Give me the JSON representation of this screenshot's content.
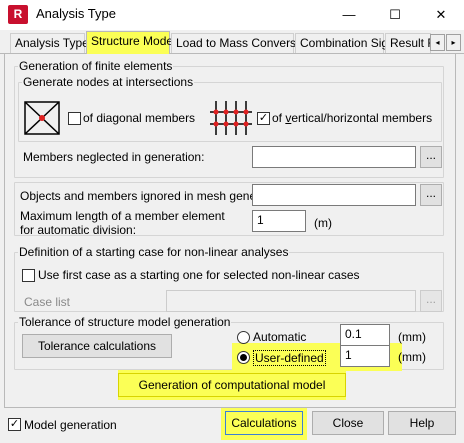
{
  "window": {
    "app_icon_text": "R",
    "title": "Analysis Type",
    "minimize_glyph": "—",
    "maximize_glyph": "☐",
    "close_glyph": "✕"
  },
  "tabs": [
    {
      "label": "Analysis Types"
    },
    {
      "label": "Structure Model"
    },
    {
      "label": "Load to Mass Conversion"
    },
    {
      "label": "Combination Sign"
    },
    {
      "label": "Result Fi"
    }
  ],
  "tab_scroll": {
    "left": "◂",
    "right": "▸"
  },
  "generation": {
    "group_label": "Generation of finite elements",
    "nodes": {
      "group_label": "Generate nodes at intersections",
      "diagonal_label": "of diagonal members",
      "diagonal_checked": false,
      "vertical_prefix": "of ",
      "vertical_underlined": "v",
      "vertical_rest": "ertical/horizontal members",
      "vertical_checked": true
    },
    "neglected_label": "Members neglected in generation:",
    "neglected_value": "",
    "ellipsis": "..."
  },
  "mesh": {
    "ignored_label": "Objects and members ignored in mesh generatic",
    "ignored_value": "",
    "max_length_label_line1": "Maximum length of a member element",
    "max_length_label_line2": "for automatic division:",
    "max_length_value": "1",
    "unit": "(m)",
    "ellipsis": "..."
  },
  "nonlinear": {
    "group_label": "Definition of a starting case for non-linear analyses",
    "use_first_label": "Use first case as a starting one for selected non-linear cases",
    "use_first_checked": false,
    "case_list_label": "Case list",
    "case_list_value": "",
    "ellipsis": "..."
  },
  "tolerance": {
    "group_label": "Tolerance of structure model generation",
    "calc_button": "Tolerance calculations",
    "automatic_label": "Automatic",
    "automatic_value": "0.1",
    "user_defined_label": "User-defined",
    "user_defined_value": "1",
    "selected": "user-defined",
    "unit": "(mm)"
  },
  "generation_button": "Generation of computational model",
  "footer": {
    "model_generation_label": "Model generation",
    "model_generation_checked": true,
    "calculations_button": "Calculations",
    "close_button": "Close",
    "help_button": "Help"
  },
  "colors": {
    "highlight": "#fbff56",
    "app_icon": "#c8102e",
    "node_marker": "#e02020"
  },
  "icons": {
    "diagonal": "diagonal-members-icon",
    "vertical_horizontal": "vertical-horizontal-members-icon"
  }
}
